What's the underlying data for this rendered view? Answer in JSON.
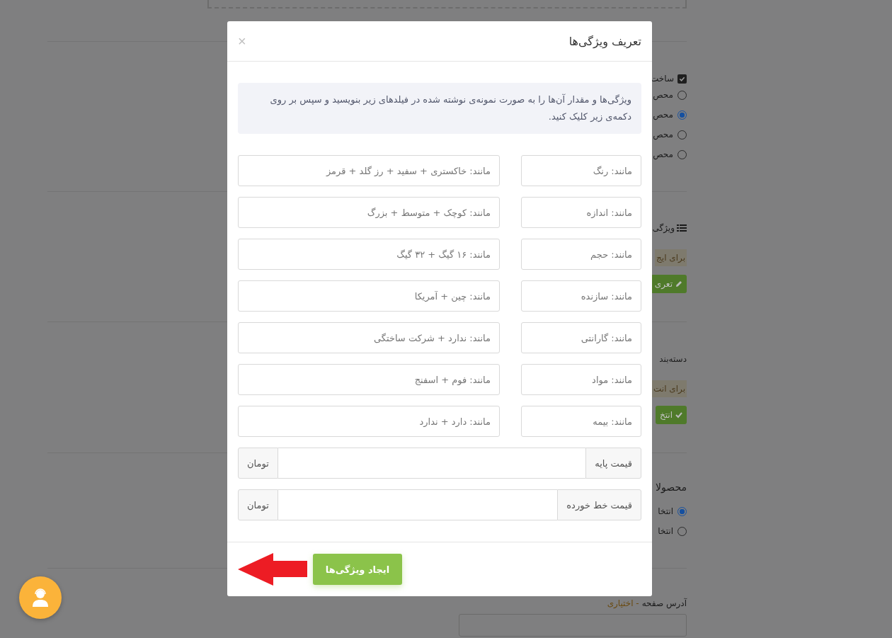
{
  "background_page": {
    "structure_section": {
      "checkbox": {
        "label": "ساخت",
        "checked": true
      },
      "options": [
        {
          "label": "محص",
          "selected": false
        },
        {
          "label": "محص",
          "selected": true
        },
        {
          "label": "محص",
          "selected": false
        },
        {
          "label": "محص",
          "selected": false
        }
      ]
    },
    "features_section": {
      "heading": "ویژگی",
      "alert": "برای ایج",
      "button": "تعری"
    },
    "category_section": {
      "heading": "دسته‌بند",
      "alert": "برای انت",
      "button": "انتخ"
    },
    "related_products_section": {
      "heading": "محصولا",
      "options": [
        {
          "label": "انتخا",
          "selected": true
        },
        {
          "label": "انتخا",
          "selected": false
        }
      ]
    },
    "page_address": {
      "label": "آدرس صفحه",
      "note": "- اختیاری"
    }
  },
  "modal": {
    "title": "تعریف ویژگی‌ها",
    "close": "×",
    "instructions": "ویژگی‌ها و مقدار آن‌ها را به صورت نمونه‌ی نوشته شده در فیلدهای زیر بنویسید و سپس بر روی دکمه‌ی زیر کلیک کنید.",
    "feature_rows": [
      {
        "name_placeholder": "مانند: رنگ",
        "values_placeholder": "مانند: خاکستری + سفید + رز گلد + قرمز"
      },
      {
        "name_placeholder": "مانند: اندازه",
        "values_placeholder": "مانند: کوچک + متوسط + بزرگ"
      },
      {
        "name_placeholder": "مانند: حجم",
        "values_placeholder": "مانند: ۱۶ گیگ + ۳۲ گیگ"
      },
      {
        "name_placeholder": "مانند: سازنده",
        "values_placeholder": "مانند: چین + آمریکا"
      },
      {
        "name_placeholder": "مانند: گارانتی",
        "values_placeholder": "مانند: ندارد + شرکت ساختگی"
      },
      {
        "name_placeholder": "مانند: مواد",
        "values_placeholder": "مانند: فوم + اسفنج"
      },
      {
        "name_placeholder": "مانند: بیمه",
        "values_placeholder": "مانند: دارد + ندارد"
      }
    ],
    "price_fields": [
      {
        "label": "قیمت پایه",
        "unit": "تومان"
      },
      {
        "label": "قیمت خط خورده",
        "unit": "تومان"
      }
    ],
    "submit": "ایجاد ویژگی‌ها"
  }
}
